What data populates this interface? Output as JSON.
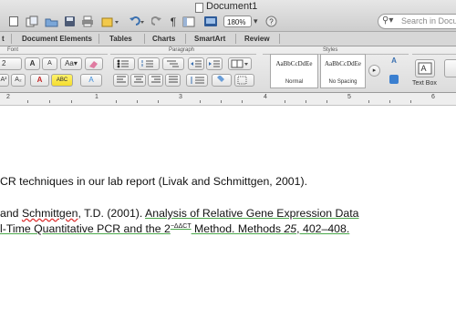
{
  "window": {
    "title": "Document1"
  },
  "toolbar": {
    "zoom_value": "180%",
    "search_placeholder": "Search in Document",
    "paragraph_mark": "¶"
  },
  "tabs": [
    "t",
    "Document Elements",
    "Tables",
    "Charts",
    "SmartArt",
    "Review"
  ],
  "ribbon": {
    "group_font": "Font",
    "group_paragraph": "Paragraph",
    "group_styles": "Styles",
    "font_size_value": "2",
    "style_sample": "AaBbCcDdEe",
    "style_normal": "Normal",
    "style_no_spacing": "No Spacing",
    "text_box_label": "Text Box",
    "font_grow": "A",
    "font_shrink": "A",
    "font_color_letter": "A",
    "highlight_letter": "A",
    "abc": "ABC"
  },
  "ruler": {
    "marks": [
      "2",
      "1",
      "3",
      "4",
      "5",
      "6"
    ]
  },
  "document": {
    "line1": "CR techniques in our lab report (Livak and Schmittgen, 2001).",
    "line2_prefix": "and ",
    "line2_name": "Schmittgen",
    "line2_mid": ", T.D. (2001). ",
    "line2_title": "Analysis of Relative Gene Expression Data",
    "line3_title_a": "l-Time Quantitative PCR and the 2",
    "line3_sup": "−ΔΔCT",
    "line3_title_b": " Method.",
    "line3_journal": " Methods ",
    "line3_volume": "25",
    "line3_pages": ", 402–408."
  },
  "colors": {
    "accent_green": "#4aa84a",
    "spell_red": "#d33"
  }
}
